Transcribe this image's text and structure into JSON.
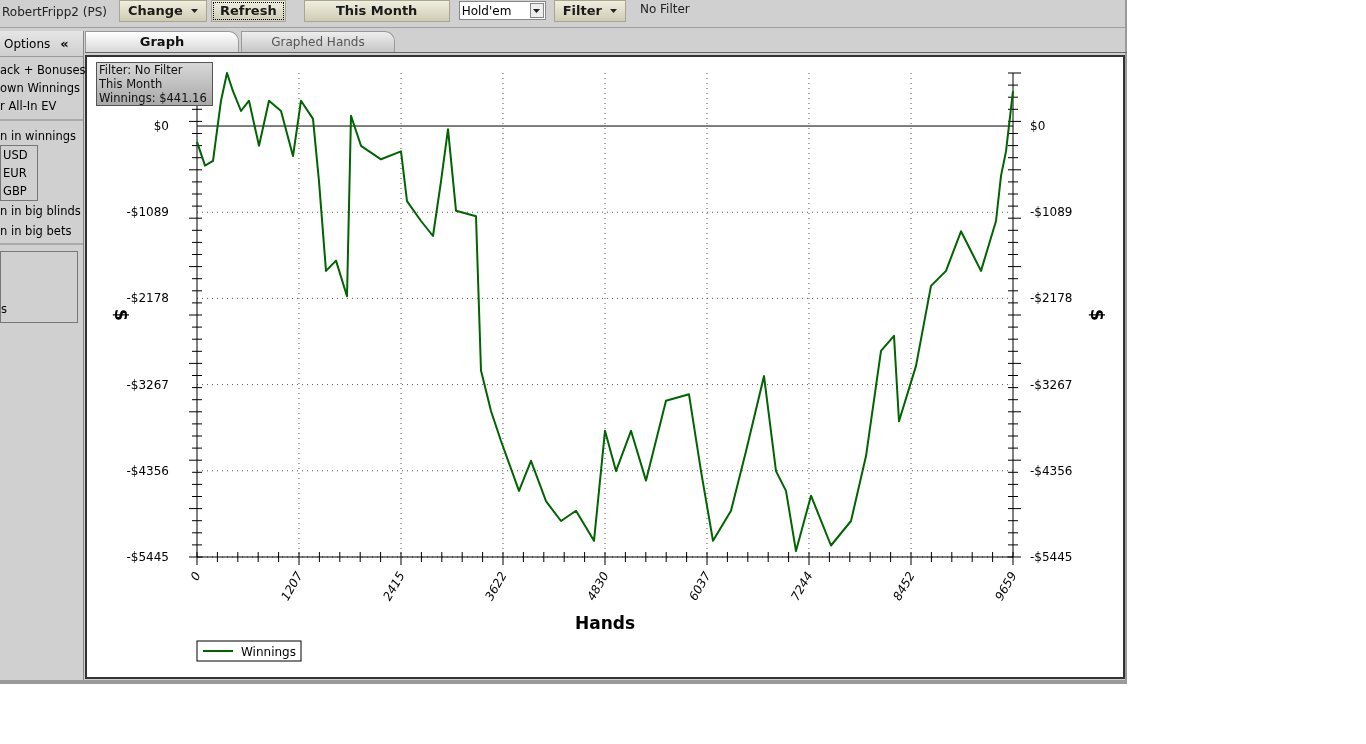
{
  "toolbar": {
    "player": "RobertFripp2 (PS)",
    "buttons": [
      {
        "label": "Change",
        "kind": "dropdown",
        "focused": false
      },
      {
        "label": "Refresh",
        "kind": "plain",
        "focused": true
      }
    ],
    "period": "This Month",
    "game_select": {
      "value": "Hold'em"
    },
    "filter_button": {
      "label": "Filter"
    },
    "filter_status": "No Filter"
  },
  "options_panel": {
    "title": "Options",
    "collapse_icon": "«",
    "items": [
      "ack + Bonuses",
      "own Winnings",
      "r All-In EV"
    ],
    "currency_label": "n in winnings",
    "currencies": [
      "USD",
      "EUR",
      "GBP"
    ],
    "unit_items": [
      "n in big blinds",
      "n in big bets"
    ],
    "group_text": "s"
  },
  "tabs": [
    {
      "label": "Graph",
      "selected": true
    },
    {
      "label": "Graphed Hands",
      "selected": false
    }
  ],
  "tooltip": [
    "Filter: No Filter",
    "This Month",
    "Winnings: $441.16"
  ],
  "chart_data": {
    "type": "line",
    "grid": true,
    "xlabel": "Hands",
    "ylabel": "$",
    "xlim": [
      0,
      9659
    ],
    "ylim": [
      -5445,
      670
    ],
    "xticks": [
      0,
      1207,
      2415,
      3622,
      4830,
      6037,
      7244,
      8452,
      9659
    ],
    "yticks": [
      {
        "value": 0,
        "label": "$0"
      },
      {
        "value": -1089,
        "label": "-$1089"
      },
      {
        "value": -2178,
        "label": "-$2178"
      },
      {
        "value": -3267,
        "label": "-$3267"
      },
      {
        "value": -4356,
        "label": "-$4356"
      },
      {
        "value": -5445,
        "label": "-$5445"
      }
    ],
    "x": [
      0,
      95,
      189,
      284,
      355,
      426,
      521,
      615,
      734,
      852,
      994,
      1136,
      1231,
      1373,
      1444,
      1527,
      1645,
      1776,
      1823,
      1941,
      2178,
      2415,
      2486,
      2651,
      2794,
      2888,
      2971,
      3066,
      3303,
      3362,
      3480,
      3598,
      3812,
      3954,
      4131,
      4309,
      4486,
      4699,
      4830,
      4960,
      5137,
      5315,
      5551,
      5824,
      5966,
      6108,
      6321,
      6499,
      6712,
      6854,
      6972,
      7090,
      7268,
      7505,
      7741,
      7919,
      8097,
      8250,
      8310,
      8511,
      8688,
      8866,
      9044,
      9280,
      9458,
      9517,
      9576,
      9659
    ],
    "series": [
      {
        "name": "Winnings",
        "color": "#006400",
        "values": [
          -200,
          -500,
          -440,
          320,
          670,
          440,
          190,
          320,
          -250,
          320,
          190,
          -380,
          320,
          90,
          -700,
          -1830,
          -1700,
          -2150,
          130,
          -250,
          -420,
          -320,
          -950,
          -1200,
          -1390,
          -700,
          -40,
          -1070,
          -1140,
          -3090,
          -3600,
          -3980,
          -4610,
          -4230,
          -4740,
          -4990,
          -4860,
          -5240,
          -3850,
          -4360,
          -3850,
          -4480,
          -3470,
          -3390,
          -4360,
          -5240,
          -4860,
          -4110,
          -3160,
          -4360,
          -4610,
          -5370,
          -4670,
          -5300,
          -4990,
          -4170,
          -2840,
          -2650,
          -3730,
          -3030,
          -2020,
          -1830,
          -1330,
          -1830,
          -1200,
          -630,
          -320,
          441
        ]
      }
    ]
  }
}
